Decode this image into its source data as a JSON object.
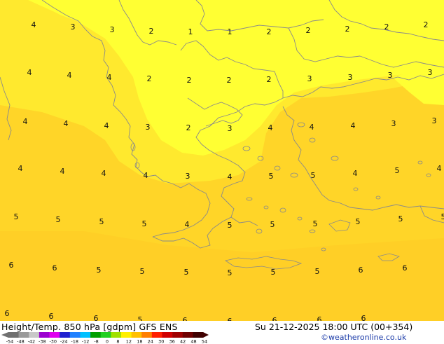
{
  "map": {
    "colors": {
      "field_light": "#ffff33",
      "field_mid": "#ffe92e",
      "field_warm": "#ffd528",
      "coastline": "#8a8a8a"
    },
    "values": [
      {
        "text": "4"
      },
      {
        "text": "3"
      },
      {
        "text": "3"
      },
      {
        "text": "2"
      },
      {
        "text": "1"
      },
      {
        "text": "1"
      },
      {
        "text": "2"
      },
      {
        "text": "2"
      },
      {
        "text": "2"
      },
      {
        "text": "2"
      },
      {
        "text": "2"
      },
      {
        "text": "4"
      },
      {
        "text": "4"
      },
      {
        "text": "4"
      },
      {
        "text": "2"
      },
      {
        "text": "2"
      },
      {
        "text": "2"
      },
      {
        "text": "2"
      },
      {
        "text": "3"
      },
      {
        "text": "3"
      },
      {
        "text": "3"
      },
      {
        "text": "3"
      },
      {
        "text": "4"
      },
      {
        "text": "4"
      },
      {
        "text": "4"
      },
      {
        "text": "3"
      },
      {
        "text": "2"
      },
      {
        "text": "3"
      },
      {
        "text": "4"
      },
      {
        "text": "4"
      },
      {
        "text": "4"
      },
      {
        "text": "3"
      },
      {
        "text": "3"
      },
      {
        "text": "4"
      },
      {
        "text": "4"
      },
      {
        "text": "4"
      },
      {
        "text": "4"
      },
      {
        "text": "3"
      },
      {
        "text": "4"
      },
      {
        "text": "5"
      },
      {
        "text": "5"
      },
      {
        "text": "4"
      },
      {
        "text": "5"
      },
      {
        "text": "4"
      },
      {
        "text": "5"
      },
      {
        "text": "5"
      },
      {
        "text": "5"
      },
      {
        "text": "5"
      },
      {
        "text": "4"
      },
      {
        "text": "5"
      },
      {
        "text": "5"
      },
      {
        "text": "5"
      },
      {
        "text": "5"
      },
      {
        "text": "5"
      },
      {
        "text": "5"
      },
      {
        "text": "6"
      },
      {
        "text": "6"
      },
      {
        "text": "5"
      },
      {
        "text": "5"
      },
      {
        "text": "5"
      },
      {
        "text": "5"
      },
      {
        "text": "5"
      },
      {
        "text": "5"
      },
      {
        "text": "6"
      },
      {
        "text": "6"
      },
      {
        "text": "6"
      },
      {
        "text": "6"
      },
      {
        "text": "6"
      },
      {
        "text": "5"
      },
      {
        "text": "6"
      },
      {
        "text": "6"
      },
      {
        "text": "6"
      },
      {
        "text": "6"
      },
      {
        "text": "6"
      }
    ]
  },
  "footer": {
    "title": "Height/Temp. 850 hPa [gdpm] GFS ENS",
    "datetime": "Su 21-12-2025 18:00 UTC (00+354)",
    "copyright": "©weatheronline.co.uk",
    "colorbar": {
      "ticks": [
        "-54",
        "-48",
        "-42",
        "-38",
        "-30",
        "-24",
        "-18",
        "-12",
        "-8",
        "0",
        "8",
        "12",
        "18",
        "24",
        "30",
        "36",
        "42",
        "48",
        "54"
      ],
      "colors": [
        "#707070",
        "#9a9a9a",
        "#c8c8c8",
        "#9b00d0",
        "#e000f0",
        "#2020d0",
        "#2080ff",
        "#00c0ff",
        "#00a000",
        "#20d020",
        "#a0e000",
        "#fff000",
        "#ffc000",
        "#ff8000",
        "#ff2000",
        "#d00000",
        "#a00000",
        "#700000",
        "#400000"
      ]
    }
  }
}
